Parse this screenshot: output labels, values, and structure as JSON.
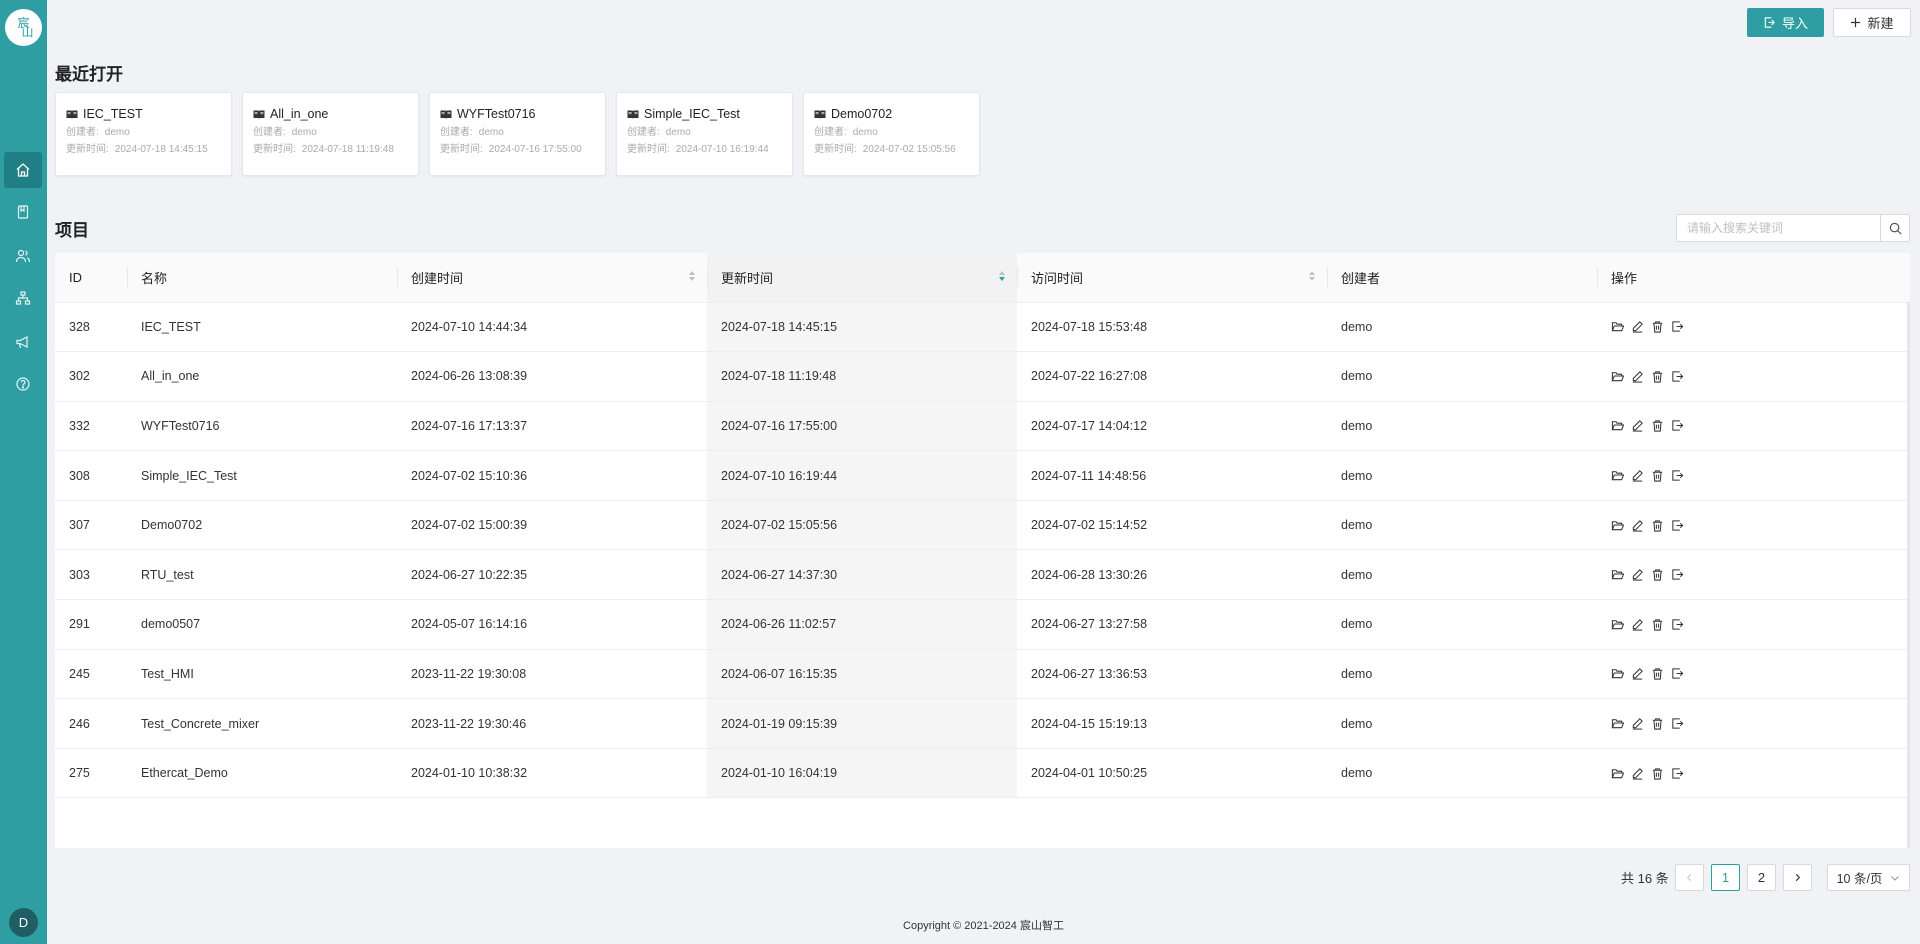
{
  "logo": {
    "line1": "宸",
    "line2": "山"
  },
  "sidebar": {
    "avatar": "D"
  },
  "toolbar": {
    "import_label": "导入",
    "new_label": "新建"
  },
  "recent": {
    "title": "最近打开",
    "creator_key": "创建者:",
    "updated_key": "更新时间:",
    "items": [
      {
        "name": "IEC_TEST",
        "creator": "demo",
        "updated": "2024-07-18 14:45:15"
      },
      {
        "name": "All_in_one",
        "creator": "demo",
        "updated": "2024-07-18 11:19:48"
      },
      {
        "name": "WYFTest0716",
        "creator": "demo",
        "updated": "2024-07-16 17:55:00"
      },
      {
        "name": "Simple_IEC_Test",
        "creator": "demo",
        "updated": "2024-07-10 16:19:44"
      },
      {
        "name": "Demo0702",
        "creator": "demo",
        "updated": "2024-07-02 15:05:56"
      }
    ]
  },
  "projects": {
    "title": "项目",
    "search_placeholder": "请输入搜索关键词",
    "columns": [
      "ID",
      "名称",
      "创建时间",
      "更新时间",
      "访问时间",
      "创建者",
      "操作"
    ],
    "rows": [
      {
        "id": "328",
        "name": "IEC_TEST",
        "created": "2024-07-10 14:44:34",
        "updated": "2024-07-18 14:45:15",
        "accessed": "2024-07-18 15:53:48",
        "creator": "demo"
      },
      {
        "id": "302",
        "name": "All_in_one",
        "created": "2024-06-26 13:08:39",
        "updated": "2024-07-18 11:19:48",
        "accessed": "2024-07-22 16:27:08",
        "creator": "demo"
      },
      {
        "id": "332",
        "name": "WYFTest0716",
        "created": "2024-07-16 17:13:37",
        "updated": "2024-07-16 17:55:00",
        "accessed": "2024-07-17 14:04:12",
        "creator": "demo"
      },
      {
        "id": "308",
        "name": "Simple_IEC_Test",
        "created": "2024-07-02 15:10:36",
        "updated": "2024-07-10 16:19:44",
        "accessed": "2024-07-11 14:48:56",
        "creator": "demo"
      },
      {
        "id": "307",
        "name": "Demo0702",
        "created": "2024-07-02 15:00:39",
        "updated": "2024-07-02 15:05:56",
        "accessed": "2024-07-02 15:14:52",
        "creator": "demo"
      },
      {
        "id": "303",
        "name": "RTU_test",
        "created": "2024-06-27 10:22:35",
        "updated": "2024-06-27 14:37:30",
        "accessed": "2024-06-28 13:30:26",
        "creator": "demo"
      },
      {
        "id": "291",
        "name": "demo0507",
        "created": "2024-05-07 16:14:16",
        "updated": "2024-06-26 11:02:57",
        "accessed": "2024-06-27 13:27:58",
        "creator": "demo"
      },
      {
        "id": "245",
        "name": "Test_HMI",
        "created": "2023-11-22 19:30:08",
        "updated": "2024-06-07 16:15:35",
        "accessed": "2024-06-27 13:36:53",
        "creator": "demo"
      },
      {
        "id": "246",
        "name": "Test_Concrete_mixer",
        "created": "2023-11-22 19:30:46",
        "updated": "2024-01-19 09:15:39",
        "accessed": "2024-04-15 15:19:13",
        "creator": "demo"
      },
      {
        "id": "275",
        "name": "Ethercat_Demo",
        "created": "2024-01-10 10:38:32",
        "updated": "2024-01-10 16:04:19",
        "accessed": "2024-04-01 10:50:25",
        "creator": "demo"
      }
    ]
  },
  "pagination": {
    "total": "共 16 条",
    "page1": "1",
    "page2": "2",
    "page_size": "10 条/页"
  },
  "footer": {
    "copyright": "Copyright © 2021-2024 宸山智工"
  },
  "colors": {
    "brand": "#2e9ea3",
    "brand_dark": "#1f7f84"
  }
}
